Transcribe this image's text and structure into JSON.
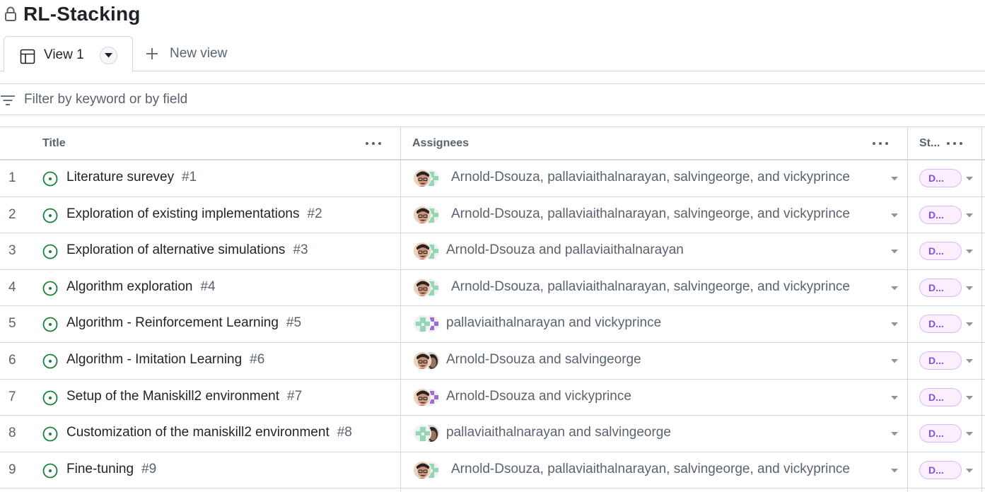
{
  "project": {
    "title": "RL-Stacking"
  },
  "tabs": {
    "active_label": "View 1",
    "new_view_label": "New view"
  },
  "filter": {
    "placeholder": "Filter by keyword or by field"
  },
  "columns": {
    "title": "Title",
    "assignees": "Assignees",
    "status": "St..."
  },
  "rows": [
    {
      "num": "1",
      "title": "Literature surevey",
      "issue": "#1",
      "assignees": "Arnold-Dsouza, pallaviaithalnarayan, salvingeorge, and vickyprince",
      "avatars": [
        "arnold",
        "pallavi"
      ],
      "status": "D..."
    },
    {
      "num": "2",
      "title": "Exploration of existing implementations",
      "issue": "#2",
      "assignees": "Arnold-Dsouza, pallaviaithalnarayan, salvingeorge, and vickyprince",
      "avatars": [
        "arnold",
        "pallavi"
      ],
      "status": "D..."
    },
    {
      "num": "3",
      "title": "Exploration of alternative simulations",
      "issue": "#3",
      "assignees": "Arnold-Dsouza and pallaviaithalnarayan",
      "avatars": [
        "arnold",
        "pallavi"
      ],
      "status": "D..."
    },
    {
      "num": "4",
      "title": "Algorithm exploration",
      "issue": "#4",
      "assignees": "Arnold-Dsouza, pallaviaithalnarayan, salvingeorge, and vickyprince",
      "avatars": [
        "arnold",
        "pallavi"
      ],
      "status": "D..."
    },
    {
      "num": "5",
      "title": "Algorithm - Reinforcement Learning",
      "issue": "#5",
      "assignees": "pallaviaithalnarayan and vickyprince",
      "avatars": [
        "pallavi",
        "vicky"
      ],
      "status": "D..."
    },
    {
      "num": "6",
      "title": "Algorithm - Imitation Learning",
      "issue": "#6",
      "assignees": "Arnold-Dsouza and salvingeorge",
      "avatars": [
        "arnold",
        "salvin"
      ],
      "status": "D..."
    },
    {
      "num": "7",
      "title": "Setup of the Maniskill2 environment",
      "issue": "#7",
      "assignees": "Arnold-Dsouza and vickyprince",
      "avatars": [
        "arnold",
        "vicky"
      ],
      "status": "D..."
    },
    {
      "num": "8",
      "title": "Customization of the maniskill2 environment",
      "issue": "#8",
      "assignees": "pallaviaithalnarayan and salvingeorge",
      "avatars": [
        "pallavi",
        "salvin"
      ],
      "status": "D..."
    },
    {
      "num": "9",
      "title": "Fine-tuning",
      "issue": "#9",
      "assignees": "Arnold-Dsouza, pallaviaithalnarayan, salvingeorge, and vickyprince",
      "avatars": [
        "arnold",
        "pallavi"
      ],
      "status": "D..."
    }
  ],
  "colors": {
    "open_issue": "#1a7f37",
    "status_bg": "#fbefff",
    "status_fg": "#8250df",
    "border": "#d0d7de",
    "muted": "#59636e"
  },
  "icons": {
    "lock": "lock-icon",
    "table": "table-icon",
    "plus": "plus-icon",
    "filter": "filter-icon",
    "issue": "issue-opened-icon",
    "more": "kebab-horizontal-icon",
    "caret": "triangle-down-icon"
  }
}
